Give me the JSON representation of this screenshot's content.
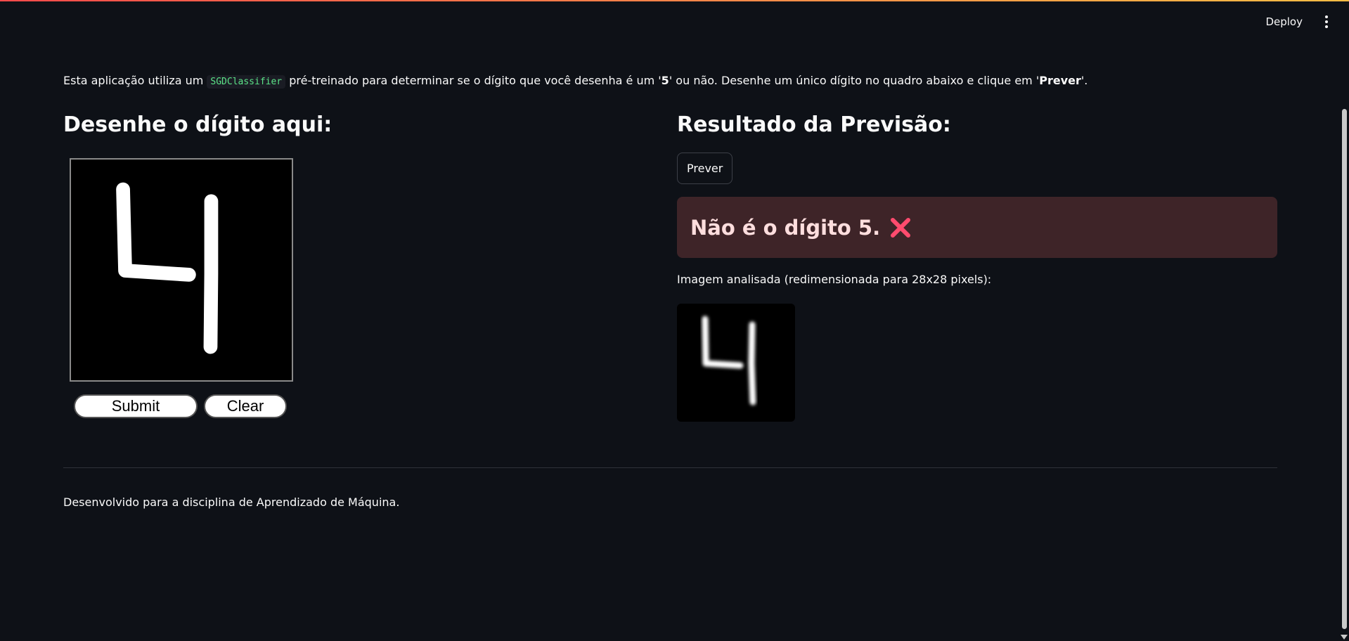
{
  "header": {
    "deploy_label": "Deploy",
    "menu_icon": "kebab-menu-icon"
  },
  "intro": {
    "part1": "Esta aplicação utiliza um ",
    "code": "SGDClassifier",
    "part2": " pré-treinado para determinar se o dígito que você desenha é um '",
    "digit": "5",
    "part3": "' ou não. Desenhe um único dígito no quadro abaixo e clique em '",
    "action": "Prever",
    "part4": "'."
  },
  "left": {
    "heading": "Desenhe o dígito aqui:",
    "submit_label": "Submit",
    "clear_label": "Clear"
  },
  "right": {
    "heading": "Resultado da Previsão:",
    "predict_label": "Prever",
    "result_text": "Não é o dígito 5.",
    "result_icon": "cross-mark-icon",
    "caption": "Imagem analisada (redimensionada para 28x28 pixels):"
  },
  "footer": {
    "text": "Desenvolvido para a disciplina de Aprendizado de Máquina."
  },
  "colors": {
    "background": "#0e1117",
    "alert_bg": "#3e2428",
    "alert_text": "#ffdede",
    "code_text": "#5ce488",
    "cross_icon": "#ff4b6e"
  }
}
